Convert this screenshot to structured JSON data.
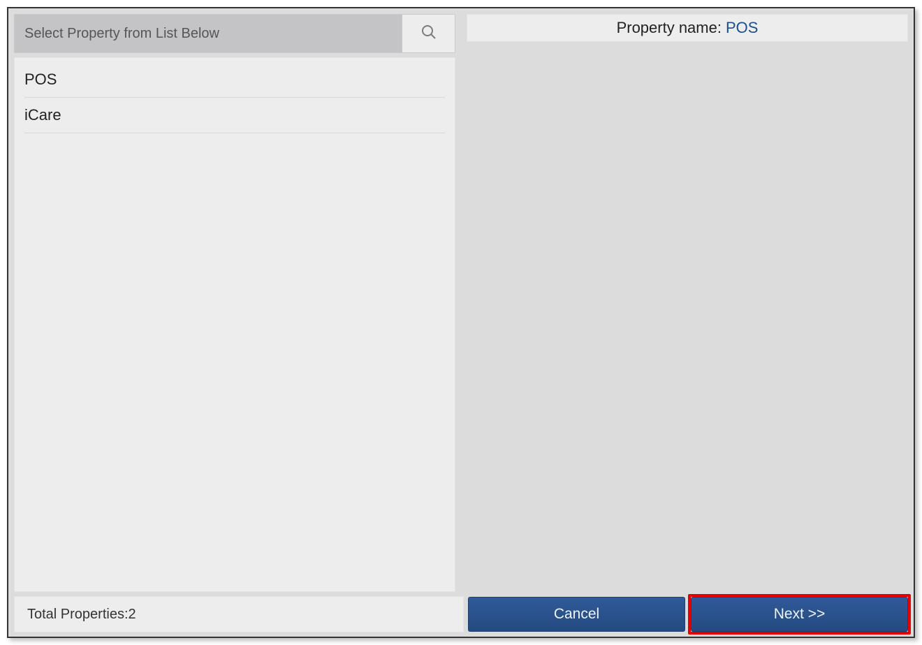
{
  "left": {
    "title": "Select Property from List Below",
    "items": [
      {
        "label": "POS"
      },
      {
        "label": "iCare"
      }
    ]
  },
  "right": {
    "property_name_label": "Property name:",
    "property_name_value": "POS"
  },
  "footer": {
    "total_label": "Total Properties:",
    "total_value": "2",
    "cancel_label": "Cancel",
    "next_label": "Next >>"
  }
}
